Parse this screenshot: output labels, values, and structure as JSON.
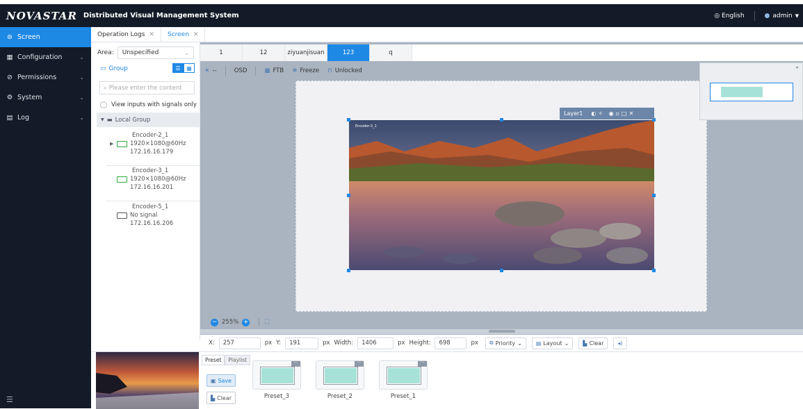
{
  "header": {
    "logo": "NOVASTAR",
    "title": "Distributed Visual Management System",
    "language": "English",
    "user": "admin"
  },
  "sidebar": {
    "items": [
      {
        "label": "Screen",
        "icon": "screen-icon"
      },
      {
        "label": "Configuration",
        "icon": "grid-icon"
      },
      {
        "label": "Permissions",
        "icon": "shield-icon"
      },
      {
        "label": "System",
        "icon": "gear-icon"
      },
      {
        "label": "Log",
        "icon": "log-icon"
      }
    ]
  },
  "page_tabs": [
    {
      "label": "Operation Logs"
    },
    {
      "label": "Screen"
    }
  ],
  "left_panel": {
    "area_label": "Area:",
    "area_value": "Unspecified",
    "group_label": "Group",
    "search_placeholder": "Please enter the content",
    "signals_only_label": "View inputs with signals only",
    "local_group": "Local Group",
    "encoders": [
      {
        "name": "Encoder-2_1",
        "signal": "1920×1080@60Hz",
        "ip": "172.16.16.179"
      },
      {
        "name": "Encoder-3_1",
        "signal": "1920×1080@60Hz",
        "ip": "172.16.16.201"
      },
      {
        "name": "Encoder-5_1",
        "signal": "No signal",
        "ip": "172.16.16.206"
      }
    ]
  },
  "screen_tabs": [
    "1",
    "12",
    "ziyuanjisuan",
    "123",
    "q"
  ],
  "toolbar": {
    "brightness": "--",
    "osd": "OSD",
    "ftb": "FTB",
    "freeze": "Freeze",
    "lock": "Unlocked"
  },
  "layer": {
    "name": "Layer1",
    "source_tag": "Encoder-3_1"
  },
  "zoom": {
    "level": "255%"
  },
  "coords": {
    "x_label": "X:",
    "x": "257",
    "y_label": "Y:",
    "y": "191",
    "w_label": "Width:",
    "w": "1406",
    "h_label": "Height:",
    "h": "698",
    "unit": "px",
    "priority": "Priority",
    "layout": "Layout",
    "clear": "Clear"
  },
  "presets": {
    "tab_preset": "Preset",
    "tab_playlist": "Playlist",
    "save": "Save",
    "clear": "Clear",
    "items": [
      "Preset_3",
      "Preset_2",
      "Preset_1"
    ]
  },
  "colors": {
    "accent": "#1e88e5",
    "nav_bg": "#131b28",
    "canvas_bg": "#a9b4c0",
    "preset_fill": "#a7e2d8"
  }
}
